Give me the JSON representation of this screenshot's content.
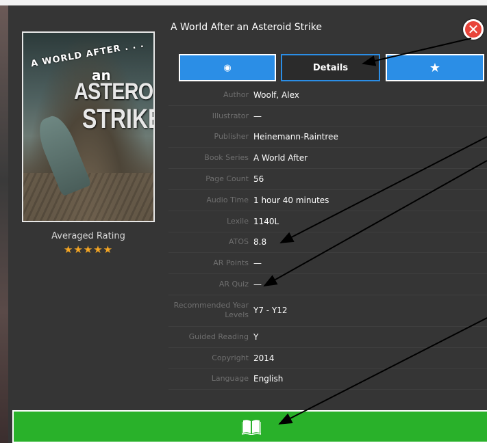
{
  "book": {
    "title": "A World After an Asteroid Strike",
    "cover_line1": "A WORLD AFTER . . .",
    "cover_line2": "an",
    "cover_line3": "ASTEROID",
    "cover_line4": "STRIKE"
  },
  "rating": {
    "label": "Averaged Rating",
    "stars": "★★★★★",
    "value": 5,
    "max": 5
  },
  "tabs": [
    {
      "icon": "eye-icon",
      "glyph": "◉"
    },
    {
      "label": "Details"
    },
    {
      "icon": "star-icon",
      "glyph": "★"
    }
  ],
  "details": [
    {
      "key": "Author",
      "value": "Woolf, Alex"
    },
    {
      "key": "Illustrator",
      "value": "—"
    },
    {
      "key": "Publisher",
      "value": "Heinemann-Raintree"
    },
    {
      "key": "Book Series",
      "value": "A World After"
    },
    {
      "key": "Page Count",
      "value": "56"
    },
    {
      "key": "Audio Time",
      "value": "1 hour 40 minutes"
    },
    {
      "key": "Lexile",
      "value": "1140L"
    },
    {
      "key": "ATOS",
      "value": "8.8"
    },
    {
      "key": "AR Points",
      "value": "—"
    },
    {
      "key": "AR Quiz",
      "value": "—"
    },
    {
      "key": "Recommended Year Levels",
      "value": "Y7 - Y12"
    },
    {
      "key": "Guided Reading",
      "value": "Y"
    },
    {
      "key": "Copyright",
      "value": "2014"
    },
    {
      "key": "Language",
      "value": "English"
    }
  ],
  "colors": {
    "accent_blue": "#2b8ee6",
    "read_green": "#29b12a",
    "close_red": "#e8443a",
    "star": "#f5a623"
  },
  "icons": {
    "close": "close-icon",
    "read": "open-book-icon"
  }
}
